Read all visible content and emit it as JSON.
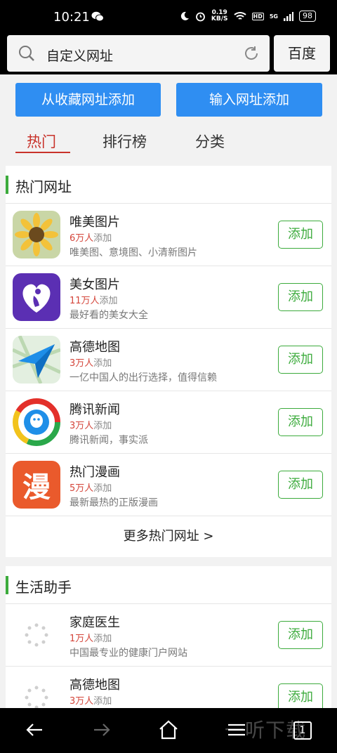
{
  "status": {
    "time": "10:21",
    "speed_top": "0.19",
    "speed_bottom": "KB/S",
    "hd": "HD",
    "network": "5G",
    "battery": "98"
  },
  "search": {
    "text": "自定义网址",
    "engine": "百度"
  },
  "actions": {
    "from_favorites": "从收藏网址添加",
    "input_url": "输入网址添加"
  },
  "tabs": [
    "热门",
    "排行榜",
    "分类"
  ],
  "hot": {
    "title": "热门网址",
    "items": [
      {
        "name": "唯美图片",
        "count": "6万人",
        "count_suffix": "添加",
        "desc": "唯美图、意境图、小清新图片",
        "button": "添加"
      },
      {
        "name": "美女图片",
        "count": "11万人",
        "count_suffix": "添加",
        "desc": "最好看的美女大全",
        "button": "添加"
      },
      {
        "name": "高德地图",
        "count": "3万人",
        "count_suffix": "添加",
        "desc": "一亿中国人的出行选择，值得信赖",
        "button": "添加"
      },
      {
        "name": "腾讯新闻",
        "count": "3万人",
        "count_suffix": "添加",
        "desc": "腾讯新闻，事实派",
        "button": "添加"
      },
      {
        "name": "热门漫画",
        "count": "5万人",
        "count_suffix": "添加",
        "desc": "最新最热的正版漫画",
        "button": "添加",
        "icon_text": "漫"
      }
    ],
    "more": "更多热门网址 >"
  },
  "life": {
    "title": "生活助手",
    "items": [
      {
        "name": "家庭医生",
        "count": "1万人",
        "count_suffix": "添加",
        "desc": "中国最专业的健康门户网站",
        "button": "添加"
      },
      {
        "name": "高德地图",
        "count": "3万人",
        "count_suffix": "添加",
        "desc": "",
        "button": "添加"
      }
    ]
  },
  "bottom": {
    "tab_count": "1",
    "watermark": "一听下载"
  },
  "colors": {
    "accent_blue": "#2f8ef2",
    "green": "#3cab3c",
    "red": "#c8322a"
  }
}
